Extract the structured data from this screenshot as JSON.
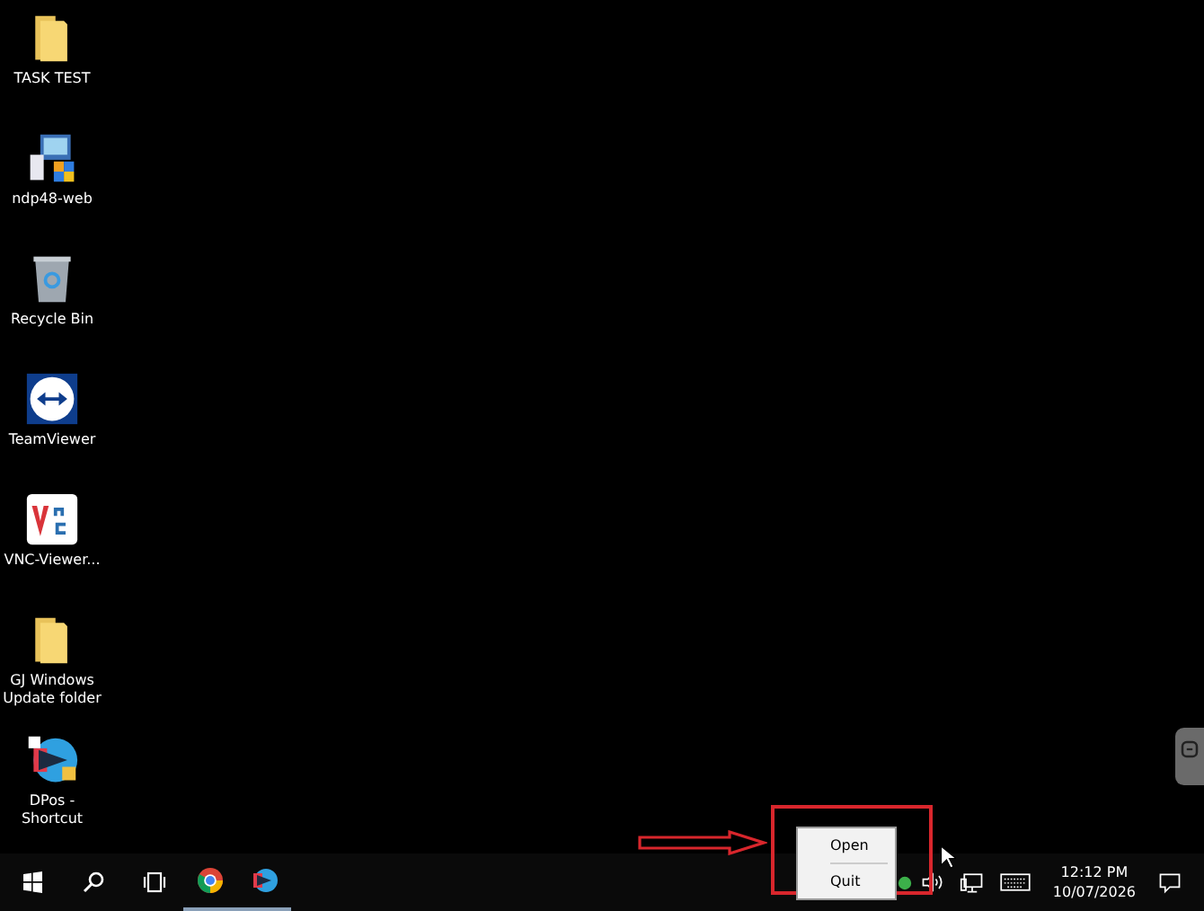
{
  "desktop_icons": [
    {
      "kind": "folder",
      "label": "TASK TEST"
    },
    {
      "kind": "installer",
      "label": "ndp48-web"
    },
    {
      "kind": "recycle-bin",
      "label": "Recycle Bin"
    },
    {
      "kind": "teamviewer",
      "label": "TeamViewer"
    },
    {
      "kind": "vnc",
      "label": "VNC-Viewer..."
    },
    {
      "kind": "folder",
      "label": "GJ Windows Update folder"
    },
    {
      "kind": "dpos",
      "label": "DPos - Shortcut"
    }
  ],
  "context_menu": {
    "items": [
      "Open",
      "Quit"
    ]
  },
  "taskbar": {
    "apps": [
      {
        "kind": "chrome",
        "running": true
      },
      {
        "kind": "dpos",
        "running": true
      }
    ]
  },
  "clock": {
    "time": "12:12 PM",
    "date": "10/07/2026"
  }
}
